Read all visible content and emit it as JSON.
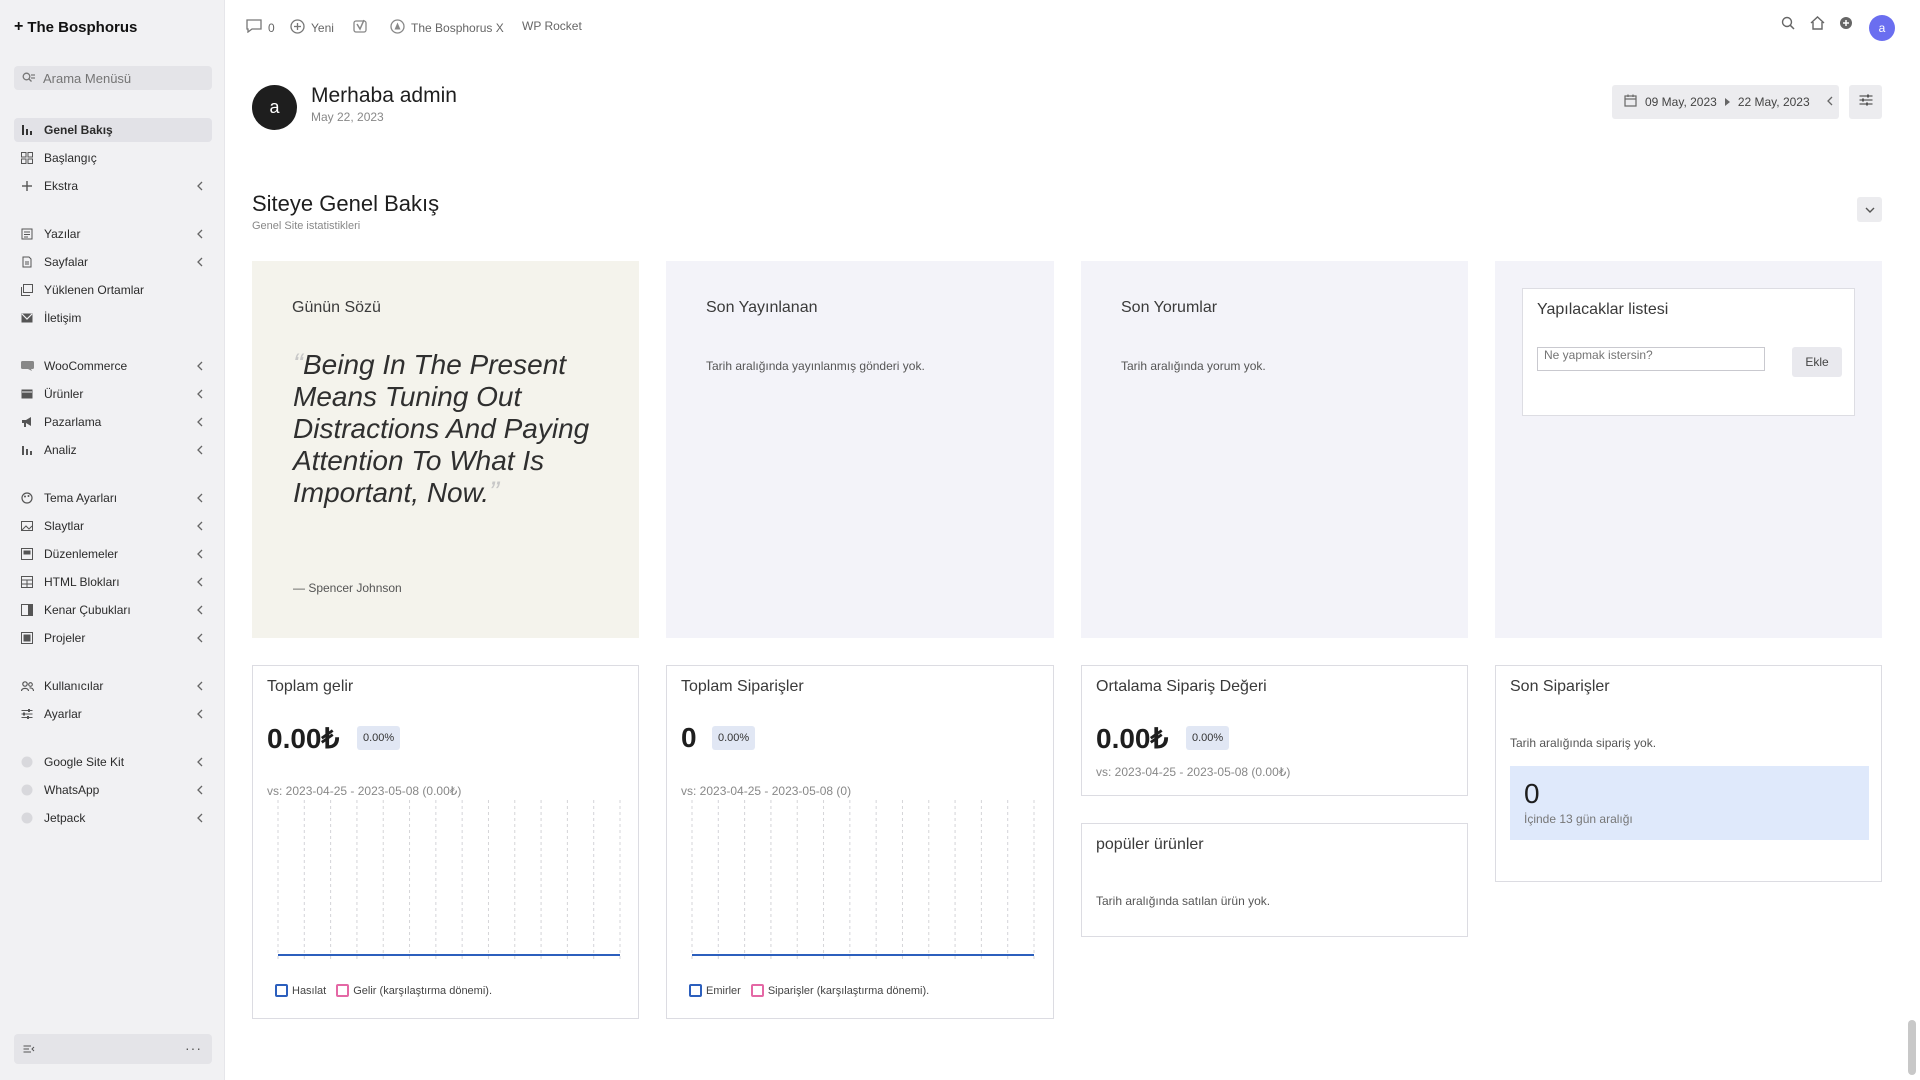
{
  "sidebar": {
    "brand": "The Bosphorus",
    "search_placeholder": "Arama Menüsü",
    "items": [
      {
        "label": "Genel Bakış"
      },
      {
        "label": "Başlangıç"
      },
      {
        "label": "Ekstra"
      },
      {
        "label": "Yazılar"
      },
      {
        "label": "Sayfalar"
      },
      {
        "label": "Yüklenen Ortamlar"
      },
      {
        "label": "İletişim"
      },
      {
        "label": "WooCommerce"
      },
      {
        "label": "Ürünler"
      },
      {
        "label": "Pazarlama"
      },
      {
        "label": "Analiz"
      },
      {
        "label": "Tema Ayarları"
      },
      {
        "label": "Slaytlar"
      },
      {
        "label": "Düzenlemeler"
      },
      {
        "label": "HTML Blokları"
      },
      {
        "label": "Kenar Çubukları"
      },
      {
        "label": "Projeler"
      },
      {
        "label": "Kullanıcılar"
      },
      {
        "label": "Ayarlar"
      },
      {
        "label": "Google Site Kit"
      },
      {
        "label": "WhatsApp"
      },
      {
        "label": "Jetpack"
      }
    ],
    "footer_more": "···"
  },
  "topbar": {
    "comments_count": "0",
    "new_label": "Yeni",
    "site_name": "The Bosphorus X",
    "rocket_label": "WP Rocket",
    "user_initial": "a"
  },
  "header": {
    "avatar_initial": "a",
    "greeting": "Merhaba admin",
    "date": "May 22, 2023",
    "range_start": "09 May, 2023",
    "range_end": "22 May, 2023"
  },
  "overview": {
    "title": "Siteye Genel Bakış",
    "subtitle": "Genel Site istatistikleri"
  },
  "quote_card": {
    "title": "Günün Sözü",
    "quote": "Being In The Present Means Tuning Out Distractions And Paying Attention To What Is Important, Now.",
    "open_mark": "“",
    "close_mark": "”",
    "author": "— Spencer Johnson"
  },
  "recent_posts": {
    "title": "Son Yayınlanan",
    "empty": "Tarih aralığında yayınlanmış gönderi yok."
  },
  "recent_comments": {
    "title": "Son Yorumlar",
    "empty": "Tarih aralığında yorum yok."
  },
  "todo": {
    "title": "Yapılacaklar listesi",
    "placeholder": "Ne yapmak istersin?",
    "add_label": "Ekle"
  },
  "revenue": {
    "title": "Toplam gelir",
    "value": "0.00₺",
    "change": "0.00%",
    "vs": "vs: 2023-04-25 - 2023-05-08 (0.00₺)",
    "legend_primary": "Hasılat",
    "legend_compare": "Gelir (karşılaştırma dönemi)."
  },
  "orders": {
    "title": "Toplam Siparişler",
    "value": "0",
    "change": "0.00%",
    "vs": "vs: 2023-04-25 - 2023-05-08 (0)",
    "legend_primary": "Emirler",
    "legend_compare": "Siparişler (karşılaştırma dönemi)."
  },
  "avg_order": {
    "title": "Ortalama Sipariş Değeri",
    "value": "0.00₺",
    "change": "0.00%",
    "vs": "vs: 2023-04-25 - 2023-05-08 (0.00₺)"
  },
  "popular": {
    "title": "popüler ürünler",
    "empty": "Tarih aralığında satılan ürün yok."
  },
  "recent_orders": {
    "title": "Son Siparişler",
    "empty": "Tarih aralığında sipariş yok.",
    "count": "0",
    "count_sub": "İçinde 13 gün aralığı"
  },
  "colors": {
    "accent": "#2c5fbd",
    "compare": "#e468a5",
    "avatar": "#6a6ef0"
  }
}
